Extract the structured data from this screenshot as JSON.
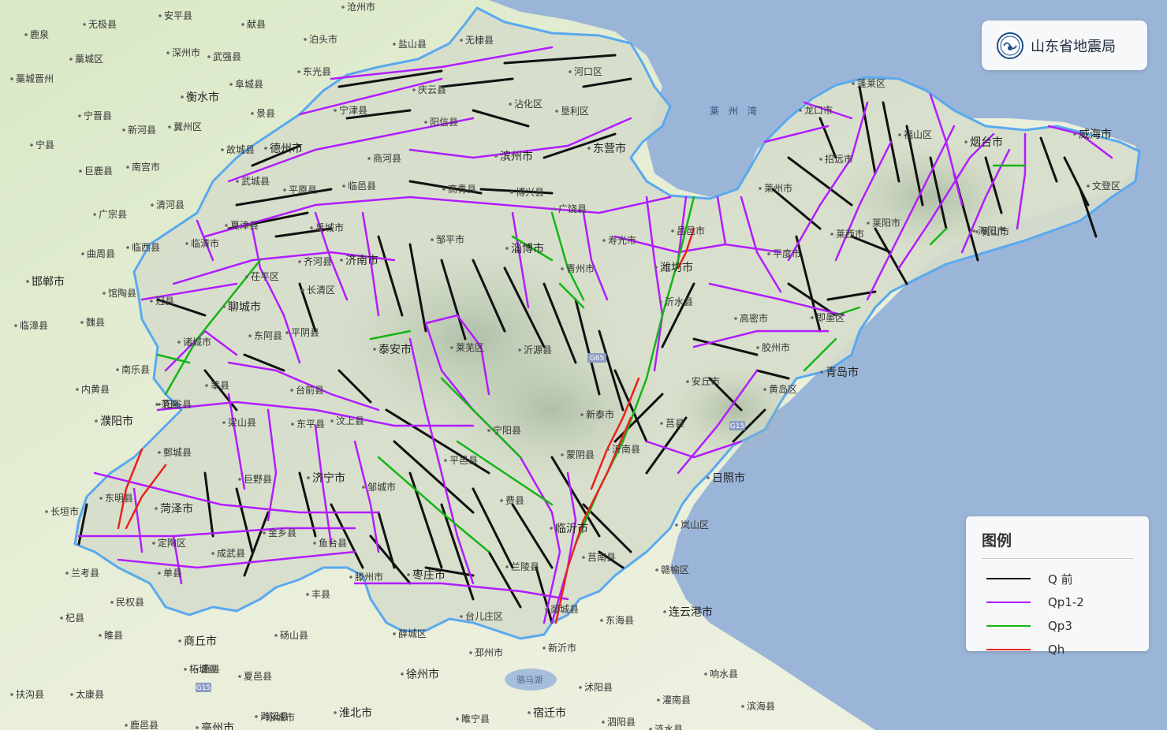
{
  "brand": {
    "title": "山东省地震局",
    "logo_icon": "seismology-bureau-logo"
  },
  "legend": {
    "title": "图例",
    "items": [
      {
        "label": "Q 前",
        "color": "#111111"
      },
      {
        "label": "Qp1-2",
        "color": "#b21cff"
      },
      {
        "label": "Qp3",
        "color": "#15b515"
      },
      {
        "label": "Qh",
        "color": "#e8231b"
      }
    ]
  },
  "map": {
    "sea_label": "莱 州 湾",
    "lake_label": "骆马湖",
    "road_badges": [
      "G65",
      "G15",
      "G15"
    ],
    "cities": [
      "沧州市",
      "无极县",
      "安平县",
      "献县",
      "鹿泉",
      "藁城区",
      "泊头市",
      "盐山县",
      "深州市",
      "武强县",
      "藁城晋州",
      "衡水市",
      "东光县",
      "阜城县",
      "宁晋县",
      "景县",
      "冀州区",
      "新河县",
      "宁县",
      "庆云县",
      "无棣县",
      "河口区",
      "宁津县",
      "沾化区",
      "垦利区",
      "巨鹿县",
      "南宫市",
      "故城县",
      "德州市",
      "阳信县",
      "滨州市",
      "东营市",
      "广宗县",
      "清河县",
      "商河县",
      "武城县",
      "临邑县",
      "平原县",
      "高青县",
      "博兴县",
      "广饶县",
      "临西县",
      "夏津县",
      "禹城市",
      "邹平市",
      "寿光市",
      "昌邑市",
      "临清市",
      "曲周县",
      "馆陶县",
      "冠县",
      "茌平区",
      "齐河县",
      "济南市",
      "淄博市",
      "青州市",
      "潍坊市",
      "聊城市",
      "长清区",
      "东阿县",
      "平阴县",
      "泰安市",
      "莱芜区",
      "沂源县",
      "新泰市",
      "沂水县",
      "安丘市",
      "诸城市",
      "莘县",
      "阳谷县",
      "台前县",
      "东平县",
      "汶上县",
      "宁阳县",
      "蒙阴县",
      "沂南县",
      "莒县",
      "日照市",
      "范县",
      "梁山县",
      "鄄城县",
      "巨野县",
      "济宁市",
      "邹城市",
      "平邑县",
      "费县",
      "临沂市",
      "岚山区",
      "东明县",
      "菏泽市",
      "定陶区",
      "成武县",
      "单县",
      "金乡县",
      "鱼台县",
      "滕州市",
      "枣庄市",
      "兰陵县",
      "莒南县",
      "郯城县",
      "新沂市",
      "东海县",
      "连云港市",
      "赣榆区",
      "长垣市",
      "兰考县",
      "民权县",
      "杞县",
      "睢县",
      "商丘市",
      "砀山县",
      "萧县",
      "徐州市",
      "邳州市",
      "台儿庄区",
      "薛城区",
      "丰县",
      "濮阳市",
      "内黄县",
      "南乐县",
      "魏县",
      "临漳县",
      "邯郸市",
      "龙口市",
      "蓬莱区",
      "招远市",
      "福山区",
      "烟台市",
      "威海市",
      "文登区",
      "莱州市",
      "莱阳市",
      "莱西市",
      "平度市",
      "海阳市",
      "乳山市",
      "即墨区",
      "胶州市",
      "青岛市",
      "黄岛区",
      "高密市",
      "柘城县",
      "宿迁市",
      "沭阳县",
      "灌南县",
      "响水县",
      "滨海县",
      "淮北市",
      "濉溪县",
      "夏邑县",
      "永城市",
      "太康县",
      "扶沟县",
      "鹿邑县",
      "亳州市",
      "睢宁县",
      "泗阳县",
      "涟水县"
    ]
  }
}
